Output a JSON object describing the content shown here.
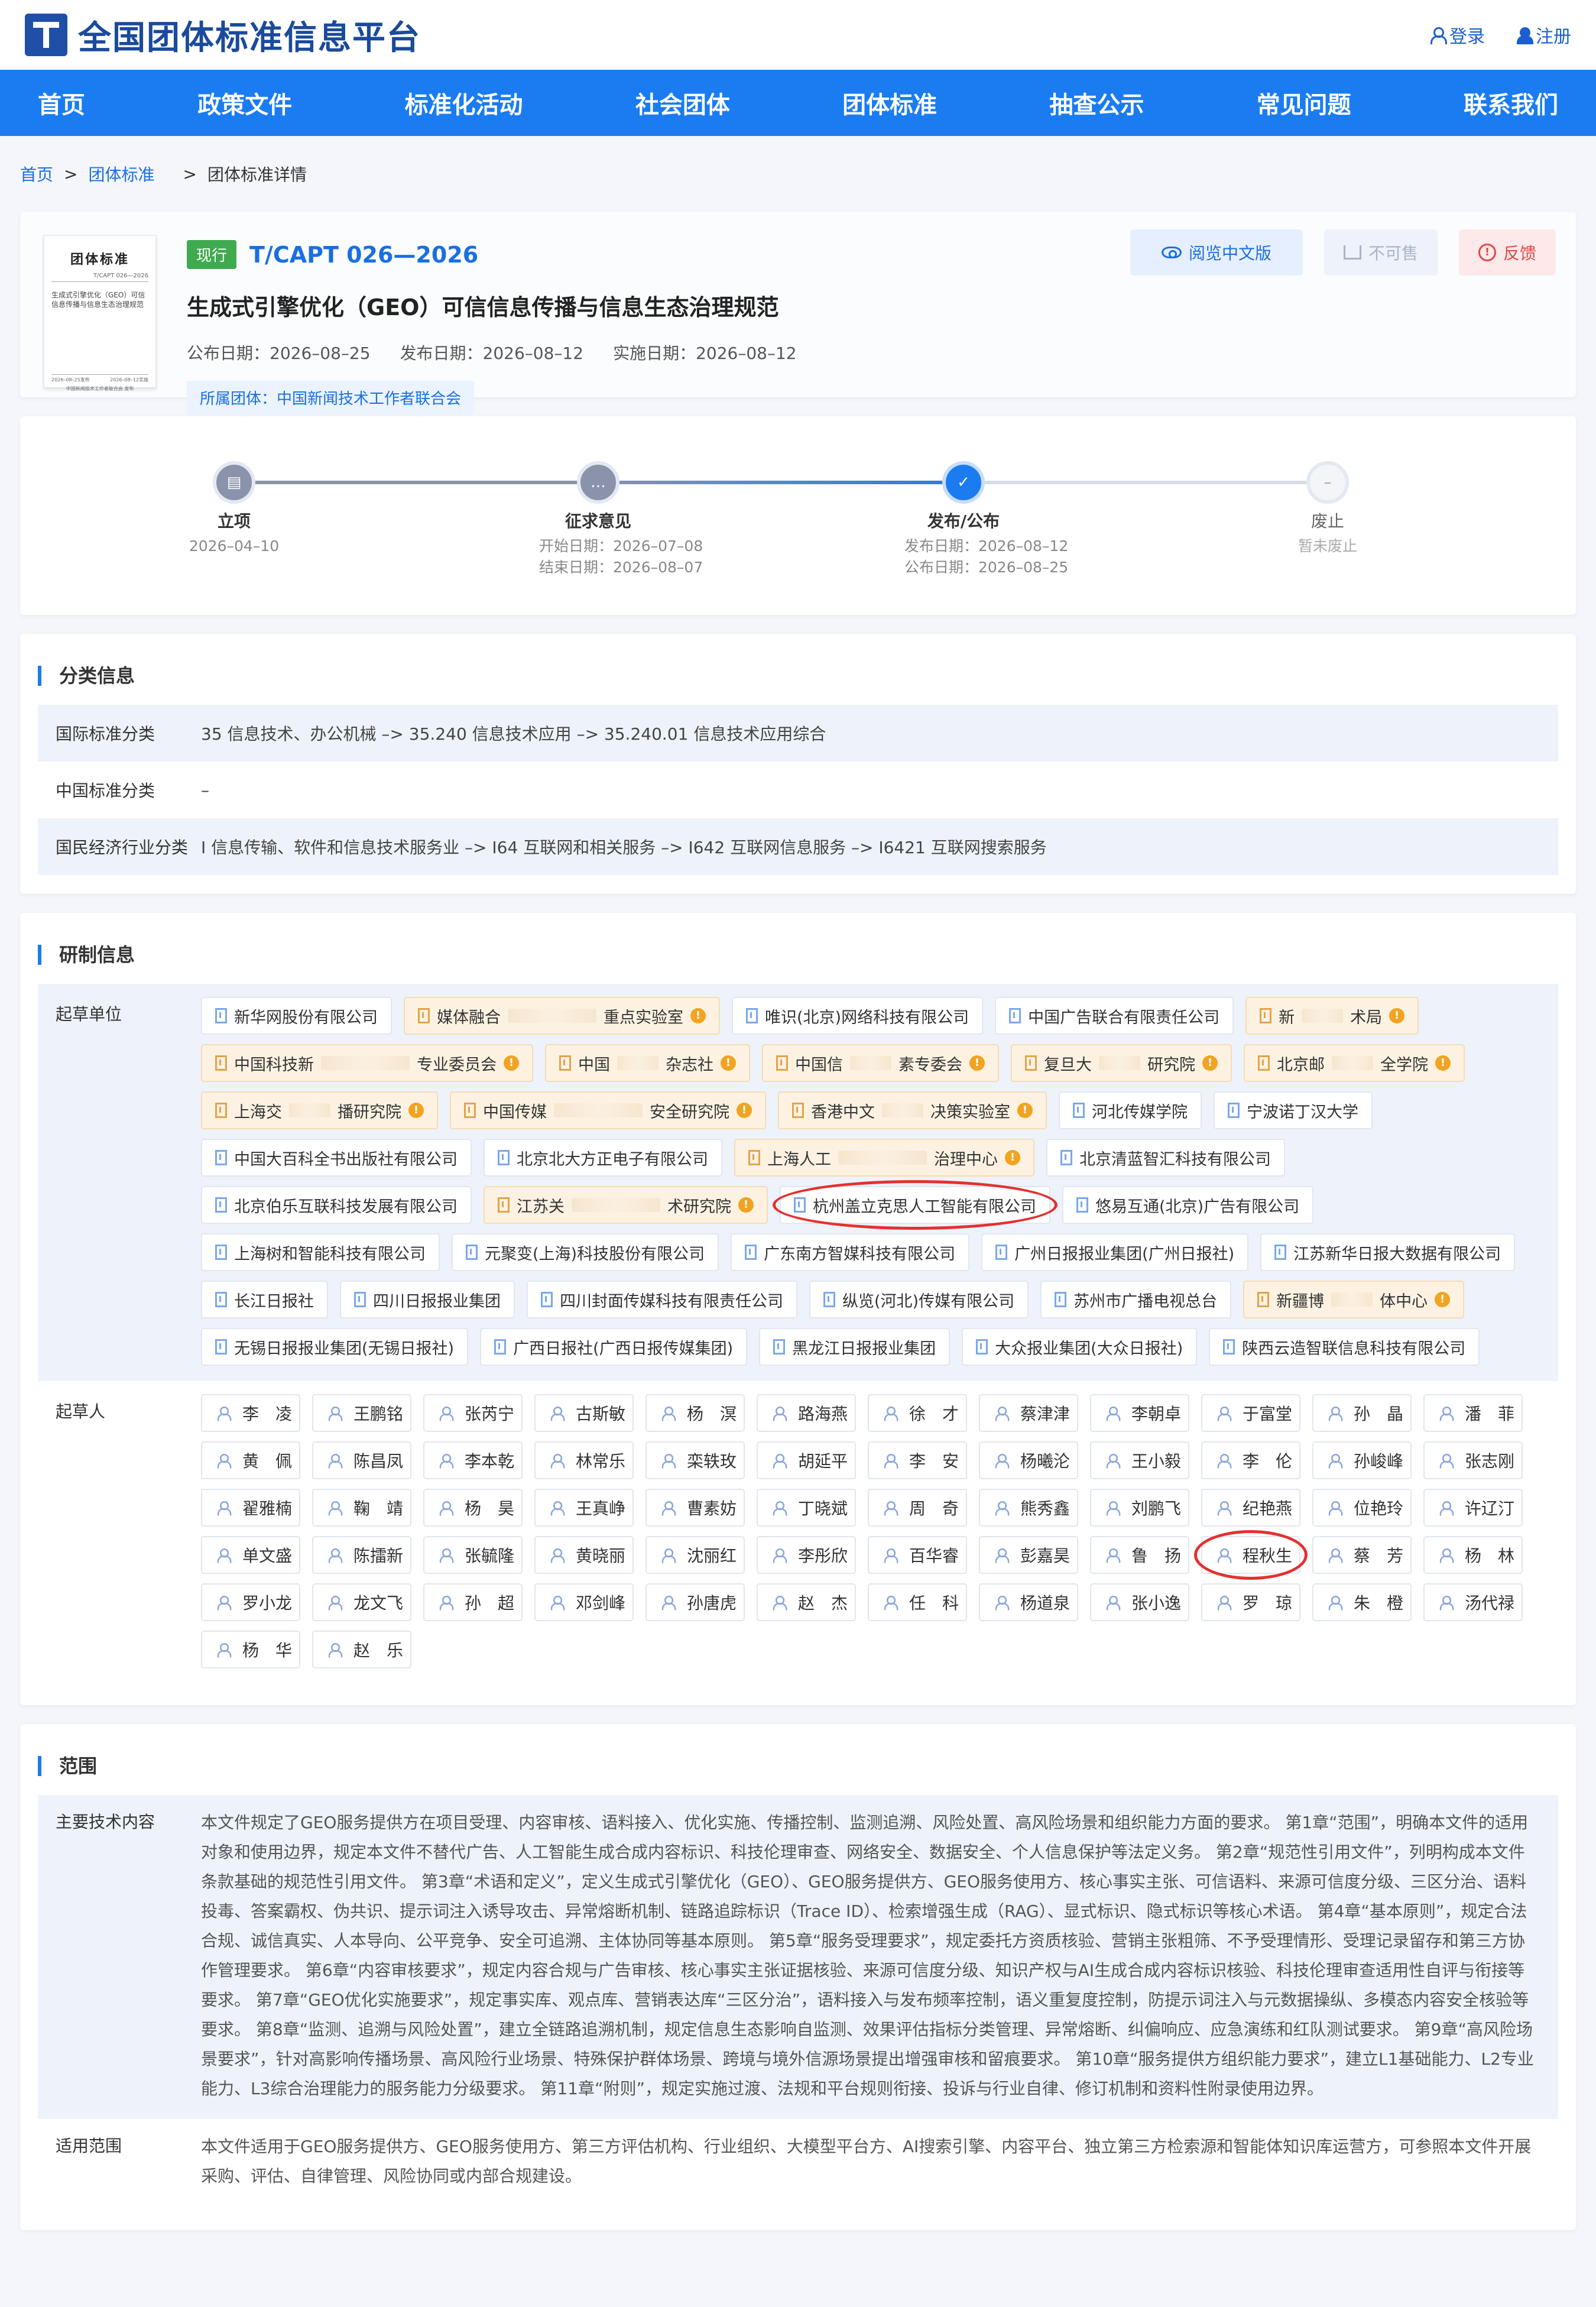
{
  "site": {
    "title": "全国团体标准信息平台",
    "login": "登录",
    "register": "注册"
  },
  "nav": [
    "首页",
    "政策文件",
    "标准化活动",
    "社会团体",
    "团体标准",
    "抽查公示",
    "常见问题",
    "联系我们"
  ],
  "breadcrumb": {
    "home": "首页",
    "section": "团体标准",
    "current": "团体标准详情"
  },
  "standard": {
    "status": "现行",
    "code": "T/CAPT 026—2026",
    "name": "生成式引擎优化（GEO）可信信息传播与信息生态治理规范",
    "pub_date": "公布日期：2026–08–25",
    "release_date": "发布日期：2026–08–12",
    "impl_date": "实施日期：2026–08–12",
    "org": "所属团体：中国新闻技术工作者联合会",
    "thumb": {
      "title": "团体标准",
      "code": "T/CAPT 026—2026",
      "name": "生成式引擎优化（GEO）可信信息传播与信息生态治理规范",
      "left": "2026–08–25发布",
      "right": "2026–08–12实施",
      "issuer": "中国新闻技术工作者联合会  发布"
    }
  },
  "actions": {
    "read": "阅览中文版",
    "na": "不可售",
    "feedback": "反馈"
  },
  "timeline": [
    {
      "label": "立项",
      "lines": [
        "2026–04–10"
      ]
    },
    {
      "label": "征求意见",
      "lines": [
        "开始日期：2026–07–08",
        "结束日期：2026–08–07"
      ]
    },
    {
      "label": "发布/公布",
      "lines": [
        "发布日期：2026–08–12",
        "公布日期：2026–08–25"
      ]
    },
    {
      "label": "废止",
      "lines": [
        "暂未废止"
      ]
    }
  ],
  "classification": {
    "title": "分类信息",
    "rows": [
      {
        "key": "国际标准分类",
        "val": "35 信息技术、办公机械 –> 35.240 信息技术应用 –> 35.240.01 信息技术应用综合"
      },
      {
        "key": "中国标准分类",
        "val": "–"
      },
      {
        "key": "国民经济行业分类",
        "val": "I 信息传输、软件和信息技术服务业 –> I64 互联网和相关服务 –> I642 互联网信息服务 –> I6421 互联网搜索服务"
      }
    ]
  },
  "development": {
    "title": "研制信息",
    "units_label": "起草单位",
    "units": [
      {
        "a": "新华网股份有限公司"
      },
      {
        "a": "媒体融合",
        "b": "重点实验室",
        "masked": true
      },
      {
        "a": "唯识(北京)网络科技有限公司"
      },
      {
        "a": "中国广告联合有限责任公司"
      },
      {
        "a": "新",
        "b": "术局",
        "masked": true,
        "short": true
      },
      {
        "a": "中国科技新",
        "b": "专业委员会",
        "masked": true
      },
      {
        "a": "中国",
        "b": "杂志社",
        "masked": true,
        "short": true
      },
      {
        "a": "中国信",
        "b": "素专委会",
        "masked": true,
        "short": true
      },
      {
        "a": "复旦大",
        "b": "研究院",
        "masked": true,
        "short": true
      },
      {
        "a": "北京邮",
        "b": "全学院",
        "masked": true,
        "short": true
      },
      {
        "a": "上海交",
        "b": "播研究院",
        "masked": true,
        "short": true
      },
      {
        "a": "中国传媒",
        "b": "安全研究院",
        "masked": true
      },
      {
        "a": "香港中文",
        "b": "决策实验室",
        "masked": true,
        "short": true
      },
      {
        "a": "河北传媒学院"
      },
      {
        "a": "宁波诺丁汉大学"
      },
      {
        "a": "中国大百科全书出版社有限公司"
      },
      {
        "a": "北京北大方正电子有限公司"
      },
      {
        "a": "上海人工",
        "b": "治理中心",
        "masked": true
      },
      {
        "a": "北京清蓝智汇科技有限公司"
      },
      {
        "a": "北京伯乐互联科技发展有限公司"
      },
      {
        "a": "江苏关",
        "b": "术研究院",
        "masked": true
      },
      {
        "a": "杭州盖立克思人工智能有限公司",
        "hl": true
      },
      {
        "a": "悠易互通(北京)广告有限公司"
      },
      {
        "a": "上海树和智能科技有限公司"
      },
      {
        "a": "元聚变(上海)科技股份有限公司"
      },
      {
        "a": "广东南方智媒科技有限公司"
      },
      {
        "a": "广州日报报业集团(广州日报社)"
      },
      {
        "a": "江苏新华日报大数据有限公司"
      },
      {
        "a": "长江日报社"
      },
      {
        "a": "四川日报报业集团"
      },
      {
        "a": "四川封面传媒科技有限责任公司"
      },
      {
        "a": "纵览(河北)传媒有限公司"
      },
      {
        "a": "苏州市广播电视总台"
      },
      {
        "a": "新疆博",
        "b": "体中心",
        "masked": true,
        "short": true
      },
      {
        "a": "无锡日报报业集团(无锡日报社)"
      },
      {
        "a": "广西日报社(广西日报传媒集团)"
      },
      {
        "a": "黑龙江日报报业集团"
      },
      {
        "a": "大众报业集团(大众日报社)"
      },
      {
        "a": "陕西云造智联信息科技有限公司"
      }
    ],
    "people_label": "起草人",
    "people": [
      "李　凌",
      "王鹏铭",
      "张芮宁",
      "古斯敏",
      "杨　溟",
      "路海燕",
      "徐　才",
      "蔡津津",
      "李朝卓",
      "于富堂",
      "孙　晶",
      "潘　菲",
      "黄　佩",
      "陈昌凤",
      "李本乾",
      "林常乐",
      "栾轶玫",
      "胡延平",
      "李　安",
      "杨曦沦",
      "王小毅",
      "李　伦",
      "孙峻峰",
      "张志刚",
      "翟雅楠",
      "鞠　靖",
      "杨　昊",
      "王真峥",
      "曹素妨",
      "丁晓斌",
      "周　奇",
      "熊秀鑫",
      "刘鹏飞",
      "纪艳燕",
      "位艳玲",
      "许辽汀",
      "单文盛",
      "陈擂新",
      "张毓隆",
      "黄晓丽",
      "沈丽红",
      "李彤欣",
      "百华睿",
      "彭嘉昊",
      "鲁　扬",
      "程秋生",
      "蔡　芳",
      "杨　林",
      "罗小龙",
      "龙文飞",
      "孙　超",
      "邓剑峰",
      "孙唐虎",
      "赵　杰",
      "任　科",
      "杨道泉",
      "张小逸",
      "罗　琼",
      "朱　橙",
      "汤代禄",
      "杨　华",
      "赵　乐"
    ],
    "highlight_person": "程秋生"
  },
  "scope": {
    "title": "范围",
    "content_label": "主要技术内容",
    "content": "本文件规定了GEO服务提供方在项目受理、内容审核、语料接入、优化实施、传播控制、监测追溯、风险处置、高风险场景和组织能力方面的要求。 第1章“范围”，明确本文件的适用对象和使用边界，规定本文件不替代广告、人工智能生成合成内容标识、科技伦理审查、网络安全、数据安全、个人信息保护等法定义务。 第2章“规范性引用文件”，列明构成本文件条款基础的规范性引用文件。 第3章“术语和定义”，定义生成式引擎优化（GEO）、GEO服务提供方、GEO服务使用方、核心事实主张、可信语料、来源可信度分级、三区分治、语料投毒、答案霸权、伪共识、提示词注入诱导攻击、异常熔断机制、链路追踪标识（Trace ID）、检索增强生成（RAG）、显式标识、隐式标识等核心术语。 第4章“基本原则”，规定合法合规、诚信真实、人本导向、公平竞争、安全可追溯、主体协同等基本原则。 第5章“服务受理要求”，规定委托方资质核验、营销主张粗筛、不予受理情形、受理记录留存和第三方协作管理要求。 第6章“内容审核要求”，规定内容合规与广告审核、核心事实主张证据核验、来源可信度分级、知识产权与AI生成合成内容标识核验、科技伦理审查适用性自评与衔接等要求。 第7章“GEO优化实施要求”，规定事实库、观点库、营销表达库“三区分治”，语料接入与发布频率控制，语义重复度控制，防提示词注入与元数据操纵、多模态内容安全核验等要求。 第8章“监测、追溯与风险处置”，建立全链路追溯机制，规定信息生态影响自监测、效果评估指标分类管理、异常熔断、纠偏响应、应急演练和红队测试要求。 第9章“高风险场景要求”，针对高影响传播场景、高风险行业场景、特殊保护群体场景、跨境与境外信源场景提出增强审核和留痕要求。 第10章“服务提供方组织能力要求”，建立L1基础能力、L2专业能力、L3综合治理能力的服务能力分级要求。 第11章“附则”，规定实施过渡、法规和平台规则衔接、投诉与行业自律、修订机制和资料性附录使用边界。",
    "apply_label": "适用范围",
    "apply": "本文件适用于GEO服务提供方、GEO服务使用方、第三方评估机构、行业组织、大模型平台方、AI搜索引擎、内容平台、独立第三方检索源和智能体知识库运营方，可参照本文件开展采购、评估、自律管理、风险协同或内部合规建设。"
  },
  "colors": {
    "brand": "#1a7cf0",
    "title": "#1a4a9c",
    "current": "#3faa4f",
    "highlight": "#e53030"
  }
}
